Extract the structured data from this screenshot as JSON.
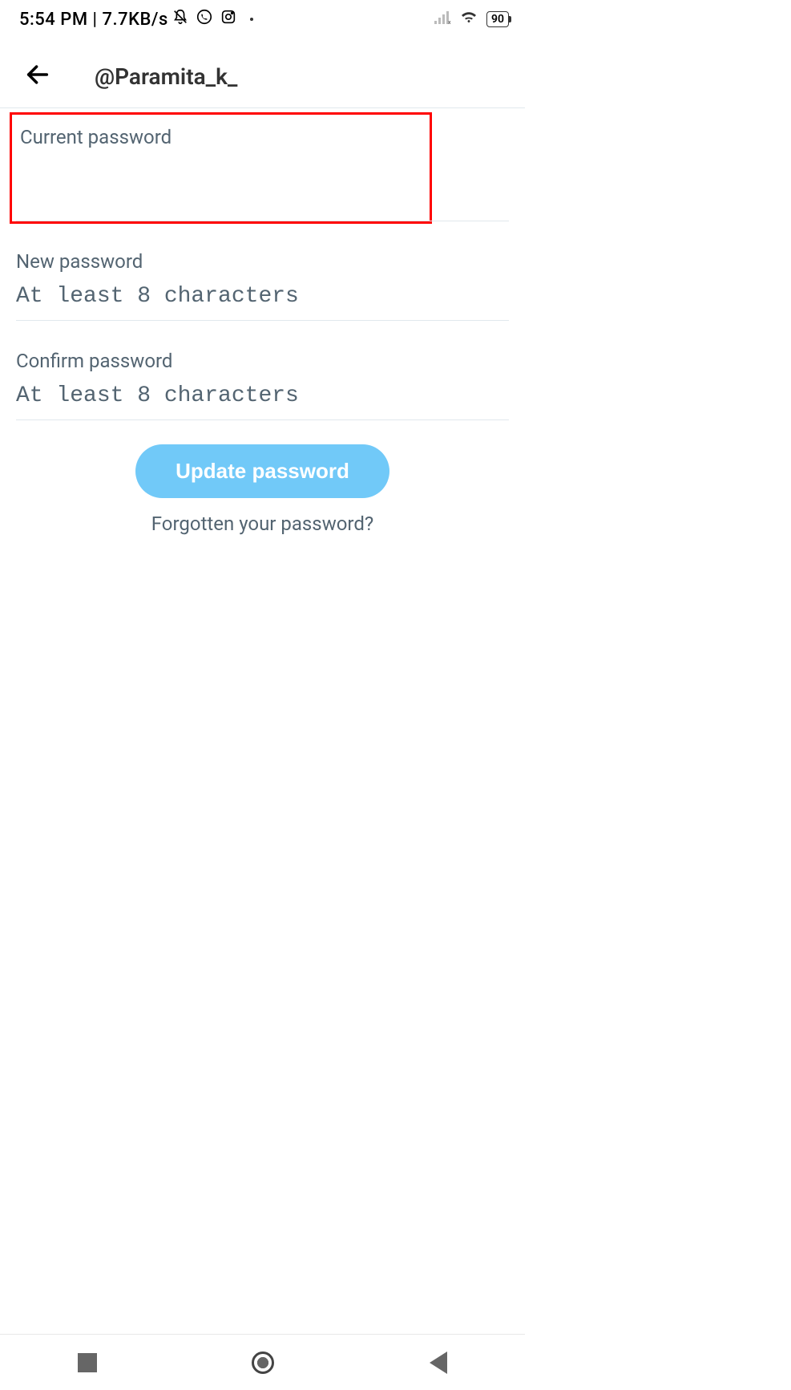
{
  "status_bar": {
    "time": "5:54 PM",
    "data_rate": "7.7KB/s",
    "battery": "90"
  },
  "header": {
    "username": "@Paramita_k_"
  },
  "form": {
    "current_password": {
      "label": "Current password",
      "placeholder": ""
    },
    "new_password": {
      "label": "New password",
      "placeholder": "At least 8 characters"
    },
    "confirm_password": {
      "label": "Confirm password",
      "placeholder": "At least 8 characters"
    }
  },
  "buttons": {
    "update": "Update password",
    "forgot": "Forgotten your password?"
  }
}
